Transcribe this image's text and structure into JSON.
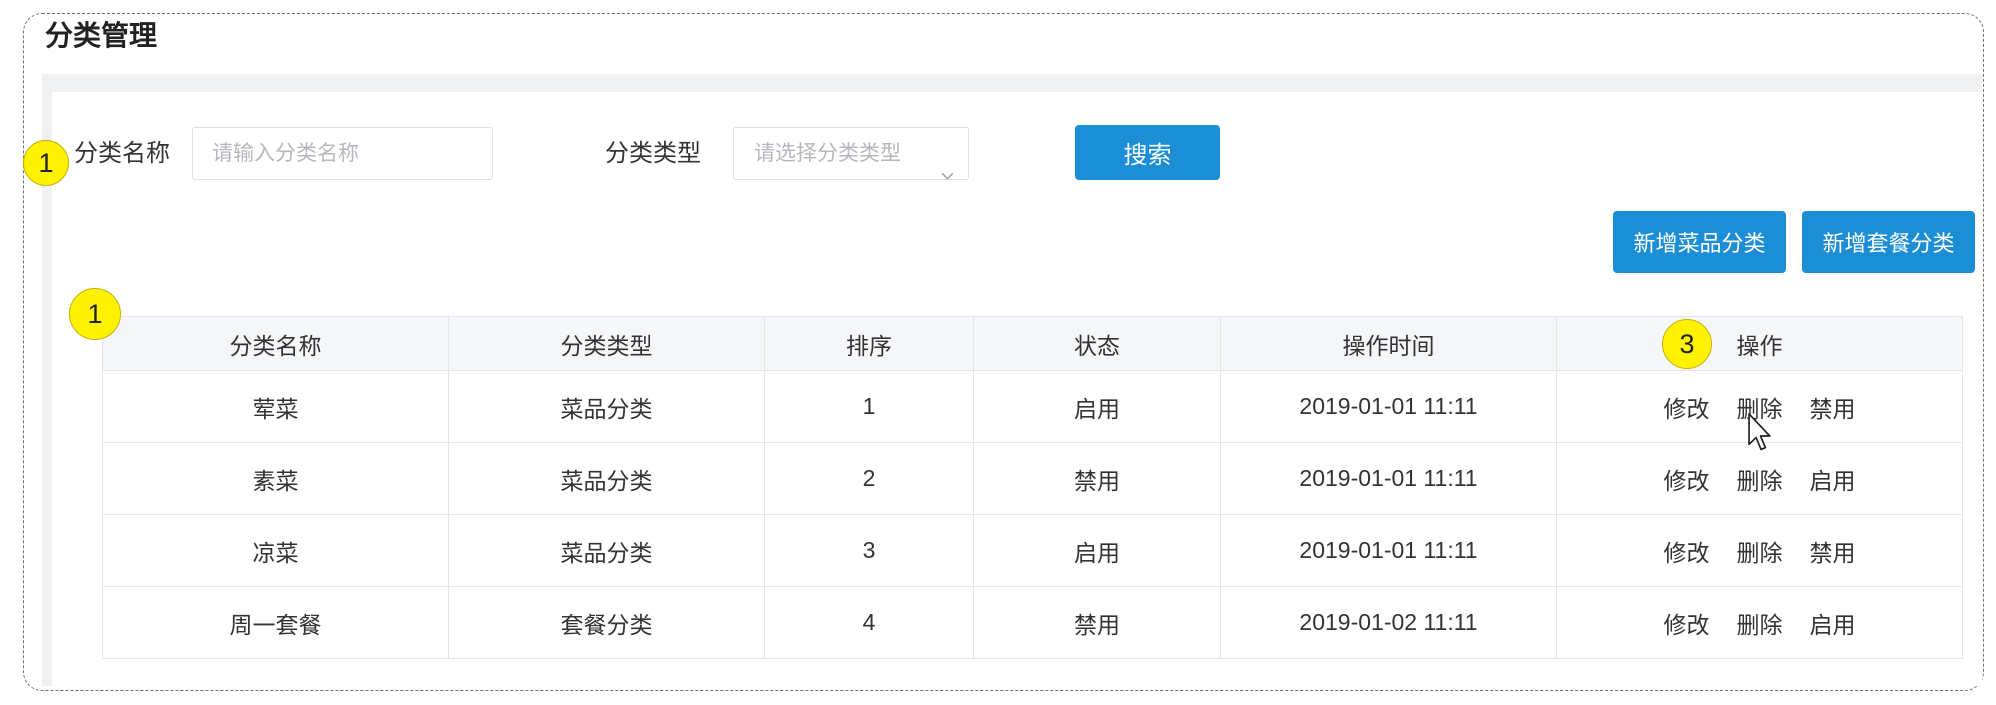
{
  "page": {
    "title": "分类管理"
  },
  "search": {
    "name_label": "分类名称",
    "name_placeholder": "请输入分类名称",
    "type_label": "分类类型",
    "type_placeholder": "请选择分类类型",
    "search_label": "搜索"
  },
  "actions": {
    "add_dish_label": "新增菜品分类",
    "add_combo_label": "新增套餐分类"
  },
  "markers": [
    "1",
    "1",
    "3"
  ],
  "table": {
    "columns": [
      "分类名称",
      "分类类型",
      "排序",
      "状态",
      "操作时间",
      "操作"
    ],
    "rows": [
      {
        "name": "荤菜",
        "type": "菜品分类",
        "sort": "1",
        "status": "启用",
        "time": "2019-01-01 11:11",
        "actions": [
          "修改",
          "删除",
          "禁用"
        ]
      },
      {
        "name": "素菜",
        "type": "菜品分类",
        "sort": "2",
        "status": "禁用",
        "time": "2019-01-01 11:11",
        "actions": [
          "修改",
          "删除",
          "启用"
        ]
      },
      {
        "name": "凉菜",
        "type": "菜品分类",
        "sort": "3",
        "status": "启用",
        "time": "2019-01-01 11:11",
        "actions": [
          "修改",
          "删除",
          "禁用"
        ]
      },
      {
        "name": "周一套餐",
        "type": "套餐分类",
        "sort": "4",
        "status": "禁用",
        "time": "2019-01-02 11:11",
        "actions": [
          "修改",
          "删除",
          "启用"
        ]
      }
    ]
  },
  "icons": {
    "select_chevron": "chevron-down-icon",
    "cursor": "mouse-pointer-icon"
  },
  "colors": {
    "primary": "#1c8ed6",
    "marker": "#fff200",
    "table_border": "#e2e5ea",
    "header_bg": "#f4f6f9",
    "placeholder": "#b4b7bd"
  }
}
